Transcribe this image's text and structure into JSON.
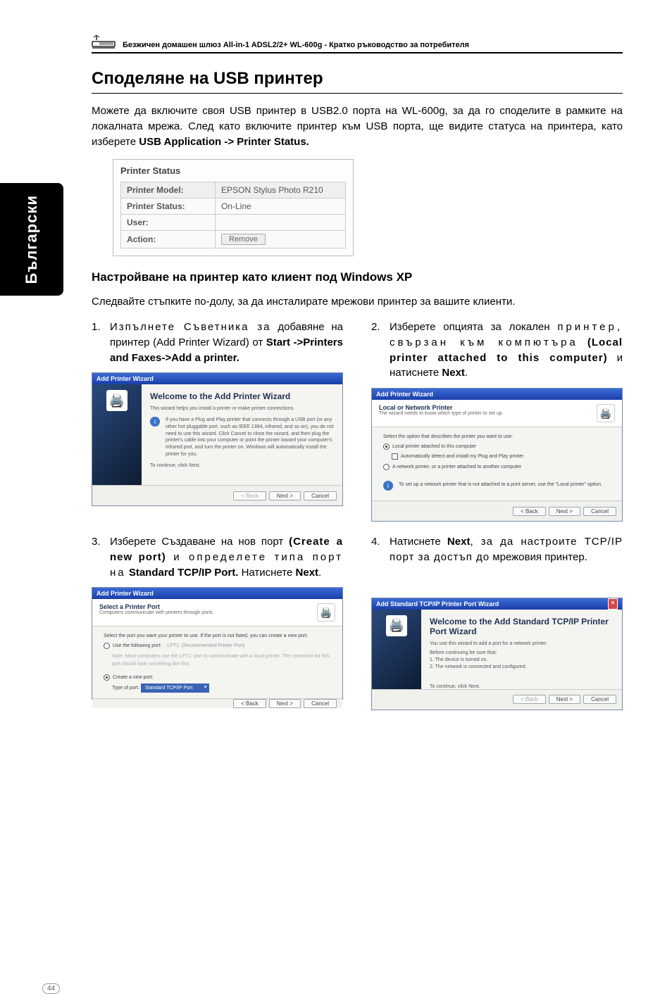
{
  "header": {
    "product_line": "Безжичен домашен шлюз All-in-1 ADSL2/2+ WL-600g - Кратко ръководство за потребителя"
  },
  "side_tab": "Български",
  "page_number": "44",
  "section_title": "Споделяне на USB принтер",
  "intro": {
    "p1_a": "Можете да включите своя USB принтер в USB2.0 порта на WL-600g, за да го споделите в рамките на локалната мрежа. След като включите принтер към USB порта, ще видите статуса на принтера, като изберете ",
    "p1_b": "USB Application -> Printer Status."
  },
  "status_box": {
    "title": "Printer Status",
    "rows": {
      "model_label": "Printer Model:",
      "model_value": "EPSON Stylus Photo R210",
      "status_label": "Printer Status:",
      "status_value": "On-Line",
      "user_label": "User:",
      "user_value": "",
      "action_label": "Action:",
      "remove_btn": "Remove"
    }
  },
  "subhead": "Настройване на принтер като клиент под Windows XP",
  "sub_p": "Следвайте стъпките по-долу, за да инсталирате мрежови принтер за вашите клиенти.",
  "steps": {
    "s1": {
      "num": "1.",
      "a": "Изпълнете Съветника за",
      "b": " добавяне на принтер (Add Printer Wizard) от ",
      "c": "Start ->Printers and Faxes->Add a printer."
    },
    "s2": {
      "num": "2.",
      "a": "Изберете опцията за локален ",
      "b": "принтер, свързан към компютъра",
      "c": " (Local printer attached to this computer)",
      "d": " и натиснете ",
      "e": "Next",
      "f": "."
    },
    "s3": {
      "num": "3.",
      "a": "Изберете Създаване на нов порт ",
      "b": "(Create a new port)",
      "c": " и определете типа порт на",
      "d": " ",
      "e": "Standard TCP/IP Port.",
      "f": " Натиснете ",
      "g": "Next",
      "h": "."
    },
    "s4": {
      "num": "4.",
      "a": "Натиснете ",
      "b": "Next",
      "c": ", за да настроите TCP/IP порт за достъп до",
      "d": " мрежовия принтер."
    }
  },
  "wiz1": {
    "title": "Add Printer Wizard",
    "heading": "Welcome to the Add Printer Wizard",
    "line1": "This wizard helps you install a printer or make printer connections.",
    "info": "If you have a Plug and Play printer that connects through a USB port (or any other hot pluggable port, such as IEEE 1394, infrared, and so on), you do not need to use this wizard. Click Cancel to close the wizard, and then plug the printer's cable into your computer or point the printer toward your computer's infrared port, and turn the printer on. Windows will automatically install the printer for you.",
    "cont": "To continue, click Next.",
    "back": "< Back",
    "next": "Next >",
    "cancel": "Cancel"
  },
  "wiz2": {
    "title": "Add Printer Wizard",
    "heading": "Local or Network Printer",
    "sub": "The wizard needs to know which type of printer to set up.",
    "prompt": "Select the option that describes the printer you want to use:",
    "opt1": "Local printer attached to this computer",
    "opt1a": "Automatically detect and install my Plug and Play printer",
    "opt2": "A network printer, or a printer attached to another computer",
    "info": "To set up a network printer that is not attached to a print server, use the \"Local printer\" option.",
    "back": "< Back",
    "next": "Next >",
    "cancel": "Cancel"
  },
  "wiz3": {
    "title": "Add Printer Wizard",
    "heading": "Select a Printer Port",
    "sub": "Computers communicate with printers through ports.",
    "prompt": "Select the port you want your printer to use. If the port is not listed, you can create a new port.",
    "opt1": "Use the following port:",
    "opt1val": "LPT1: (Recommended Printer Port)",
    "note": "Note: Most computers use the LPT1: port to communicate with a local printer. The connector for this port should look something like this:",
    "opt2": "Create a new port:",
    "typeport_lbl": "Type of port:",
    "typeport_val": "Standard TCP/IP Port",
    "back": "< Back",
    "next": "Next >",
    "cancel": "Cancel"
  },
  "wiz4": {
    "title": "Add Standard TCP/IP Printer Port Wizard",
    "heading": "Welcome to the Add Standard TCP/IP Printer Port Wizard",
    "line1": "You use this wizard to add a port for a network printer.",
    "line2": "Before continuing be sure that:",
    "b1": "1. The device is turned on.",
    "b2": "2. The network is connected and configured.",
    "cont": "To continue, click Next.",
    "back": "< Back",
    "next": "Next >",
    "cancel": "Cancel"
  }
}
